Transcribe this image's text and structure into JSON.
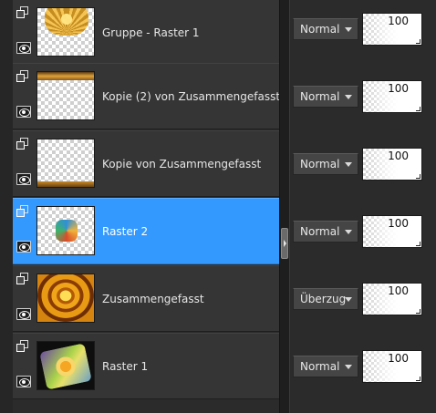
{
  "layers": [
    {
      "name": "Gruppe - Raster 1",
      "blend_mode": "Normal",
      "opacity": "100",
      "opacity_fraction": 1.0,
      "selected": false
    },
    {
      "name": "Kopie (2) von Zusammengefasst",
      "blend_mode": "Normal",
      "opacity": "100",
      "opacity_fraction": 1.0,
      "selected": false
    },
    {
      "name": "Kopie von Zusammengefasst",
      "blend_mode": "Normal",
      "opacity": "100",
      "opacity_fraction": 1.0,
      "selected": false
    },
    {
      "name": "Raster 2",
      "blend_mode": "Normal",
      "opacity": "100",
      "opacity_fraction": 1.0,
      "selected": true
    },
    {
      "name": "Zusammengefasst",
      "blend_mode": "Überzug",
      "opacity": "100",
      "opacity_fraction": 1.0,
      "selected": false
    },
    {
      "name": "Raster 1",
      "blend_mode": "Normal",
      "opacity": "100",
      "opacity_fraction": 1.0,
      "selected": false
    }
  ],
  "colors": {
    "selection": "#3399ff",
    "row_background": "#353535",
    "panel_background": "#2b2b2b"
  },
  "icons": {
    "layer_type": "layer-group-icon",
    "visibility": "eye-icon",
    "dropdown": "chevron-down-icon"
  }
}
